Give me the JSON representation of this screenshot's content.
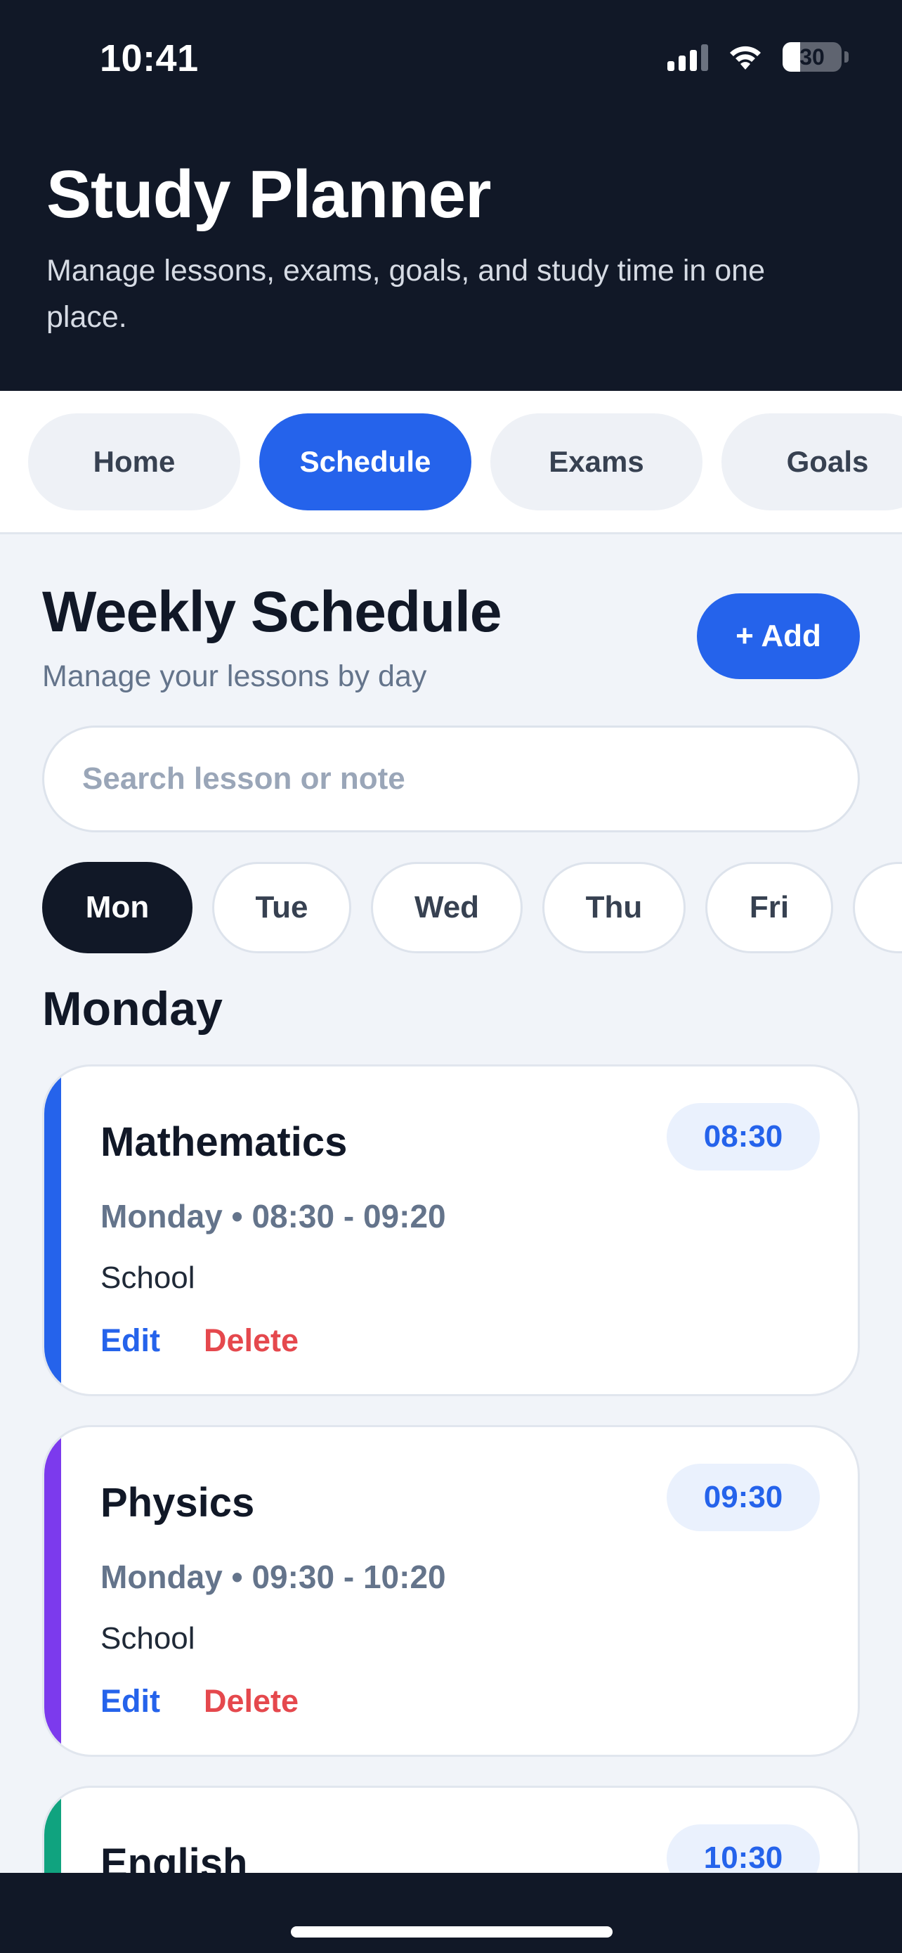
{
  "status_bar": {
    "time": "10:41",
    "battery_level": "30",
    "icons": [
      "signal-icon",
      "wifi-icon",
      "battery-icon"
    ]
  },
  "header": {
    "title": "Study Planner",
    "subtitle": "Manage lessons, exams, goals, and study time in one place."
  },
  "tabs": [
    {
      "label": "Home",
      "active": false
    },
    {
      "label": "Schedule",
      "active": true
    },
    {
      "label": "Exams",
      "active": false
    },
    {
      "label": "Goals",
      "active": false
    }
  ],
  "schedule": {
    "title": "Weekly Schedule",
    "subtitle": "Manage your lessons by day",
    "add_label": "+ Add",
    "search": {
      "value": "",
      "placeholder": "Search lesson or note"
    },
    "days": [
      {
        "label": "Mon",
        "active": true
      },
      {
        "label": "Tue",
        "active": false
      },
      {
        "label": "Wed",
        "active": false
      },
      {
        "label": "Thu",
        "active": false
      },
      {
        "label": "Fri",
        "active": false
      }
    ],
    "selected_day": "Monday",
    "lessons": [
      {
        "title": "Mathematics",
        "time_badge": "08:30",
        "meta": "Monday • 08:30 - 09:20",
        "place": "School",
        "edit_label": "Edit",
        "delete_label": "Delete",
        "accent_color": "#2563eb"
      },
      {
        "title": "Physics",
        "time_badge": "09:30",
        "meta": "Monday • 09:30 - 10:20",
        "place": "School",
        "edit_label": "Edit",
        "delete_label": "Delete",
        "accent_color": "#7c3aed"
      },
      {
        "title": "English",
        "time_badge": "10:30",
        "accent_color": "#10a37f"
      }
    ]
  },
  "colors": {
    "header_bg": "#111827",
    "primary": "#2563eb",
    "danger": "#e5484d",
    "page_bg": "#f1f4f9"
  }
}
